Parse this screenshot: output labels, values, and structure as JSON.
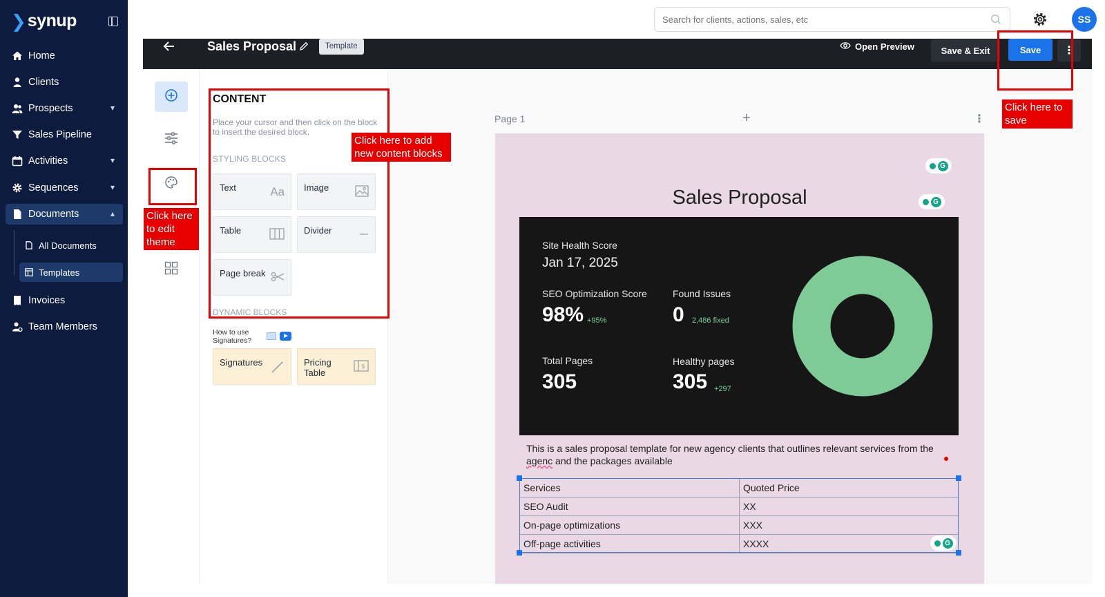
{
  "sidebar": {
    "brand": "synup",
    "items": [
      {
        "label": "Home",
        "icon": "home-icon"
      },
      {
        "label": "Clients",
        "icon": "user-icon"
      },
      {
        "label": "Prospects",
        "icon": "users-icon"
      },
      {
        "label": "Sales Pipeline",
        "icon": "funnel-icon"
      },
      {
        "label": "Activities",
        "icon": "calendar-icon"
      },
      {
        "label": "Sequences",
        "icon": "gear-icon"
      },
      {
        "label": "Documents",
        "icon": "document-icon"
      },
      {
        "label": "Invoices",
        "icon": "invoice-icon"
      },
      {
        "label": "Team Members",
        "icon": "team-icon"
      }
    ],
    "documents_sub": [
      {
        "label": "All Documents",
        "icon": "file-icon"
      },
      {
        "label": "Templates",
        "icon": "template-icon"
      }
    ]
  },
  "header": {
    "search_placeholder": "Search for clients, actions, sales, etc",
    "avatar_initials": "SS"
  },
  "editor": {
    "doc_title": "Sales Proposal",
    "badge": "Template",
    "open_preview": "Open Preview",
    "save_exit": "Save & Exit",
    "save": "Save",
    "more": "⋮"
  },
  "panel": {
    "heading": "CONTENT",
    "hint": "Place your cursor and then click on the block to insert the desired block.",
    "styling_heading": "STYLING BLOCKS",
    "styling_blocks": [
      {
        "label": "Text",
        "icon": "Aa"
      },
      {
        "label": "Image",
        "icon": "image-icon"
      },
      {
        "label": "Table",
        "icon": "table-icon"
      },
      {
        "label": "Divider",
        "icon": "divider-icon"
      },
      {
        "label": "Page break",
        "icon": "scissors-icon"
      }
    ],
    "dynamic_heading": "DYNAMIC BLOCKS",
    "signature_help": "How to use Signatures?",
    "dynamic_blocks": [
      {
        "label": "Signatures",
        "icon": "pen-icon"
      },
      {
        "label": "Pricing Table",
        "icon": "pricing-icon"
      }
    ]
  },
  "canvas": {
    "page_label": "Page 1",
    "title": "Sales Proposal",
    "dashboard": {
      "site_health_label": "Site Health Score",
      "date": "Jan 17, 2025",
      "seo_label": "SEO Optimization Score",
      "seo_value": "98%",
      "seo_delta": "+95%",
      "issues_label": "Found Issues",
      "issues_value": "0",
      "issues_delta": "2,486 fixed",
      "pages_label": "Total Pages",
      "pages_value": "305",
      "healthy_label": "Healthy pages",
      "healthy_value": "305",
      "healthy_delta": "+297",
      "donut_color": "#7ecb98"
    },
    "description_prefix": "This is a sales proposal template for new agency clients that outlines relevant services from the",
    "description_misspelled": "agenc",
    "description_suffix": "and the packages available",
    "table": {
      "headers": [
        "Services",
        "Quoted Price"
      ],
      "rows": [
        [
          "SEO Audit",
          "XX"
        ],
        [
          "On-page optimizations",
          "XXX"
        ],
        [
          "Off-page activities",
          "XXXX"
        ]
      ]
    }
  },
  "annotations": {
    "theme": "Click here to edit theme",
    "content": "Click here to add new content blocks",
    "save": "Click here to save"
  },
  "colors": {
    "sidebar_bg": "#0d1b3e",
    "accent": "#1a73e8",
    "annotation_red": "#e60000",
    "page_bg": "#ead9e4"
  }
}
